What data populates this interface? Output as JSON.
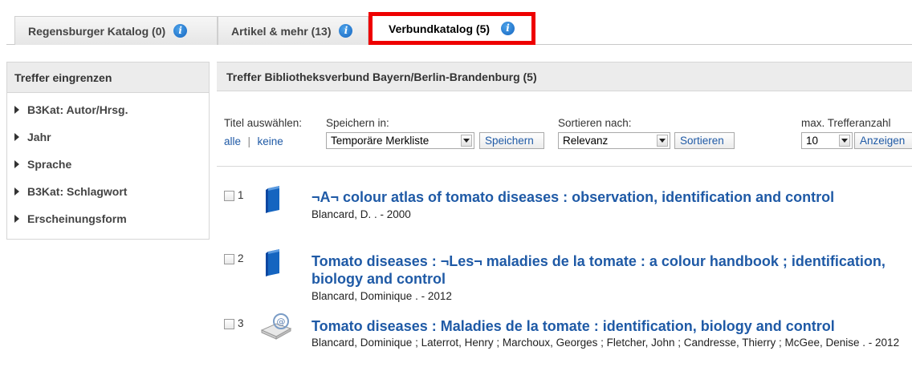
{
  "tabs": [
    {
      "label": "Regensburger Katalog (0)",
      "active": false
    },
    {
      "label": "Artikel & mehr (13)",
      "active": false
    },
    {
      "label": "Verbundkatalog (5)",
      "active": true
    }
  ],
  "sidebar": {
    "title": "Treffer eingrenzen",
    "facets": [
      "B3Kat: Autor/Hrsg.",
      "Jahr",
      "Sprache",
      "B3Kat: Schlagwort",
      "Erscheinungsform"
    ]
  },
  "results_header": "Treffer Bibliotheksverbund Bayern/Berlin-Brandenburg (5)",
  "controls": {
    "select_titles_label": "Titel auswählen:",
    "select_all": "alle",
    "select_separator": "|",
    "select_none": "keine",
    "save_in_label": "Speichern in:",
    "save_in_value": "Temporäre Merkliste",
    "save_button": "Speichern",
    "sort_label": "Sortieren nach:",
    "sort_value": "Relevanz",
    "sort_button": "Sortieren",
    "max_label": "max. Trefferanzahl",
    "max_value": "10",
    "show_button": "Anzeigen"
  },
  "results": [
    {
      "number": "1",
      "icon": "book-icon",
      "title": "¬A¬ colour atlas of tomato diseases : observation, identification and control",
      "meta": "Blancard, D. . - 2000"
    },
    {
      "number": "2",
      "icon": "book-icon",
      "title": "Tomato diseases : ¬Les¬ maladies de la tomate : a colour handbook ; identification, biology and control",
      "meta": "Blancard, Dominique . - 2012"
    },
    {
      "number": "3",
      "icon": "ebook-icon",
      "title": "Tomato diseases : Maladies de la tomate : identification, biology and control",
      "meta": "Blancard, Dominique ; Laterrot, Henry ; Marchoux, Georges ; Fletcher, John ; Candresse, Thierry ; McGee, Denise . - 2012"
    }
  ],
  "colors": {
    "link": "#1f5aa6",
    "active_tab_border": "#ee0000",
    "header_bg": "#ececec"
  }
}
